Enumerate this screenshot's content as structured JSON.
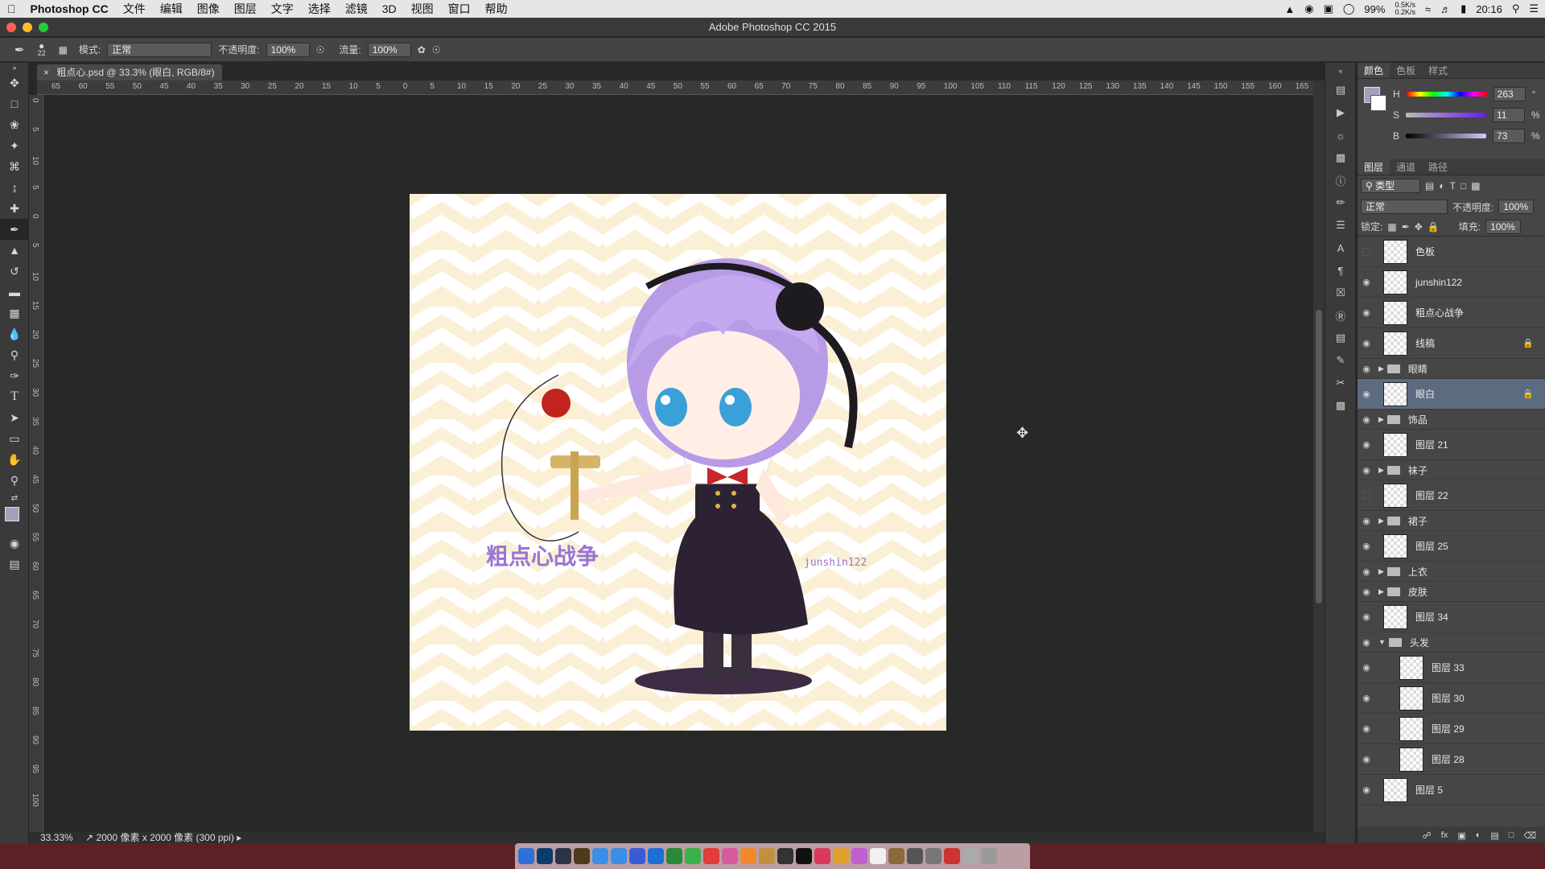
{
  "menubar": {
    "app": "Photoshop CC",
    "items": [
      "文件",
      "编辑",
      "图像",
      "图层",
      "文字",
      "选择",
      "滤镜",
      "3D",
      "视图",
      "窗口",
      "帮助"
    ],
    "battery": "99%",
    "net_up": "0.5K/s",
    "net_down": "0.2K/s",
    "time": "20:16"
  },
  "window": {
    "title": "Adobe Photoshop CC 2015"
  },
  "options": {
    "brush_size": "22",
    "mode_label": "模式:",
    "mode_value": "正常",
    "opacity_label": "不透明度:",
    "opacity_value": "100%",
    "flow_label": "流量:",
    "flow_value": "100%"
  },
  "document": {
    "tab": "粗点心.psd @ 33.3% (眼白, RGB/8#)",
    "zoom": "33.33%",
    "info": "2000 像素 x 2000 像素 (300 ppi)"
  },
  "ruler": {
    "h_ticks": [
      "65",
      "60",
      "55",
      "50",
      "45",
      "40",
      "35",
      "30",
      "25",
      "20",
      "15",
      "10",
      "5",
      "0",
      "5",
      "10",
      "15",
      "20",
      "25",
      "30",
      "35",
      "40",
      "45",
      "50",
      "55",
      "60",
      "65",
      "70",
      "75",
      "80",
      "85",
      "90",
      "95",
      "100",
      "105",
      "110",
      "115",
      "120",
      "125",
      "130",
      "135",
      "140",
      "145",
      "150",
      "155",
      "160",
      "165"
    ],
    "v_ticks": [
      "0",
      "5",
      "10",
      "5",
      "0",
      "5",
      "10",
      "15",
      "20",
      "25",
      "30",
      "35",
      "40",
      "45",
      "50",
      "55",
      "60",
      "65",
      "70",
      "75",
      "80",
      "85",
      "90",
      "95",
      "100"
    ]
  },
  "artwork": {
    "text_title": "粗点心战争",
    "text_sign": "junshin122"
  },
  "color_panel": {
    "tabs": [
      "颜色",
      "色板",
      "样式"
    ],
    "h_label": "H",
    "h_value": "263",
    "s_label": "S",
    "s_value": "11",
    "b_label": "B",
    "b_value": "73",
    "deg": "°",
    "pct": "%"
  },
  "layers_panel": {
    "tabs": [
      "图层",
      "通道",
      "路径"
    ],
    "kind": "类型",
    "blend": "正常",
    "opacity_label": "不透明度:",
    "opacity_value": "100%",
    "lock_label": "锁定:",
    "fill_label": "填充:",
    "fill_value": "100%",
    "layers": [
      {
        "name": "色板",
        "type": "layer",
        "visible": false
      },
      {
        "name": "junshin122",
        "type": "layer",
        "visible": true
      },
      {
        "name": "粗点心战争",
        "type": "layer",
        "visible": true
      },
      {
        "name": "线稿",
        "type": "layer",
        "visible": true,
        "locked": true
      },
      {
        "name": "眼睛",
        "type": "group",
        "visible": true
      },
      {
        "name": "眼白",
        "type": "layer",
        "visible": true,
        "locked": true,
        "selected": true
      },
      {
        "name": "饰品",
        "type": "group",
        "visible": true
      },
      {
        "name": "图层 21",
        "type": "layer",
        "visible": true
      },
      {
        "name": "袜子",
        "type": "group",
        "visible": true
      },
      {
        "name": "图层 22",
        "type": "layer",
        "visible": false
      },
      {
        "name": "裙子",
        "type": "group",
        "visible": true
      },
      {
        "name": "图层 25",
        "type": "layer",
        "visible": true
      },
      {
        "name": "上衣",
        "type": "group",
        "visible": true
      },
      {
        "name": "皮肤",
        "type": "group",
        "visible": true
      },
      {
        "name": "图层 34",
        "type": "layer",
        "visible": true
      },
      {
        "name": "头发",
        "type": "group",
        "visible": true,
        "open": true
      },
      {
        "name": "图层 33",
        "type": "layer",
        "visible": true,
        "indent": true
      },
      {
        "name": "图层 30",
        "type": "layer",
        "visible": true,
        "indent": true
      },
      {
        "name": "图层 29",
        "type": "layer",
        "visible": true,
        "indent": true
      },
      {
        "name": "图层 28",
        "type": "layer",
        "visible": true,
        "indent": true
      },
      {
        "name": "图层 5",
        "type": "layer",
        "visible": true
      }
    ]
  }
}
